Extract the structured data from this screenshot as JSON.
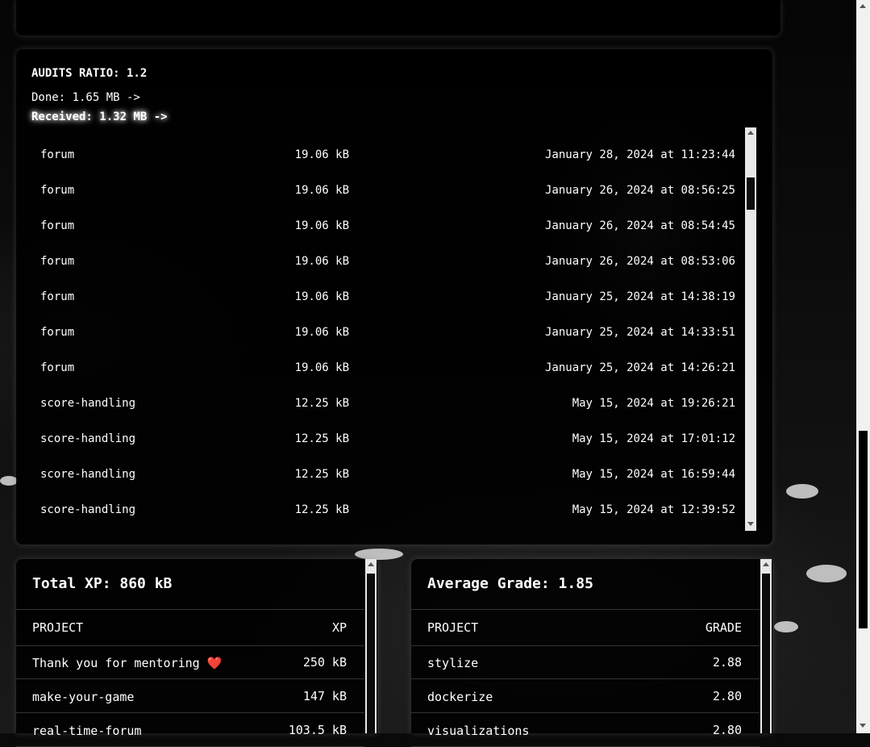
{
  "audits": {
    "title": "AUDITS RATIO: 1.2",
    "done": "Done: 1.65 MB ->",
    "received": "Received: 1.32 MB ->",
    "rows": [
      {
        "project": "forum",
        "size": "19.06 kB",
        "date": "January 28, 2024 at 11:23:44"
      },
      {
        "project": "forum",
        "size": "19.06 kB",
        "date": "January 26, 2024 at 08:56:25"
      },
      {
        "project": "forum",
        "size": "19.06 kB",
        "date": "January 26, 2024 at 08:54:45"
      },
      {
        "project": "forum",
        "size": "19.06 kB",
        "date": "January 26, 2024 at 08:53:06"
      },
      {
        "project": "forum",
        "size": "19.06 kB",
        "date": "January 25, 2024 at 14:38:19"
      },
      {
        "project": "forum",
        "size": "19.06 kB",
        "date": "January 25, 2024 at 14:33:51"
      },
      {
        "project": "forum",
        "size": "19.06 kB",
        "date": "January 25, 2024 at 14:26:21"
      },
      {
        "project": "score-handling",
        "size": "12.25 kB",
        "date": "May 15, 2024 at 19:26:21"
      },
      {
        "project": "score-handling",
        "size": "12.25 kB",
        "date": "May 15, 2024 at 17:01:12"
      },
      {
        "project": "score-handling",
        "size": "12.25 kB",
        "date": "May 15, 2024 at 16:59:44"
      },
      {
        "project": "score-handling",
        "size": "12.25 kB",
        "date": "May 15, 2024 at 12:39:52"
      }
    ]
  },
  "xp": {
    "title": "Total XP: 860 kB",
    "col_project": "PROJECT",
    "col_value": "XP",
    "rows": [
      {
        "project": "Thank you for mentoring ❤️",
        "value": "250 kB"
      },
      {
        "project": "make-your-game",
        "value": "147 kB"
      },
      {
        "project": "real-time-forum",
        "value": "103.5 kB"
      }
    ]
  },
  "grades": {
    "title": "Average Grade: 1.85",
    "col_project": "PROJECT",
    "col_value": "GRADE",
    "rows": [
      {
        "project": "stylize",
        "value": "2.88"
      },
      {
        "project": "dockerize",
        "value": "2.80"
      },
      {
        "project": "visualizations",
        "value": "2.80"
      }
    ]
  },
  "colors": {
    "panel": "#000000",
    "text": "#ffffff",
    "heart": "#e0334c"
  }
}
